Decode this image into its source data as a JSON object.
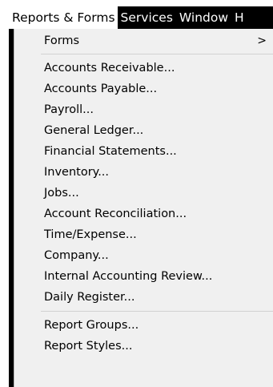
{
  "menubar": {
    "items": [
      {
        "label": "Reports & Forms",
        "active": true
      },
      {
        "label": "Services",
        "active": false
      },
      {
        "label": "Window",
        "active": false
      },
      {
        "label": "H",
        "active": false
      }
    ]
  },
  "menu": {
    "forms": {
      "label": "Forms",
      "submenu_icon": "chevron-right-icon",
      "submenu_glyph": ">"
    },
    "items": [
      "Accounts Receivable...",
      "Accounts Payable...",
      "Payroll...",
      "General Ledger...",
      "Financial Statements...",
      "Inventory...",
      "Jobs...",
      "Account Reconciliation...",
      "Time/Expense...",
      "Company...",
      "Internal Accounting Review...",
      "Daily Register..."
    ],
    "bottom_items": [
      "Report Groups...",
      "Report Styles..."
    ]
  },
  "colors": {
    "menubar_bg": "#000000",
    "menubar_text": "#ffffff",
    "active_menu_bg": "#ffffff",
    "dropdown_bg": "#f0f0f0",
    "separator": "#d2d2d2"
  }
}
